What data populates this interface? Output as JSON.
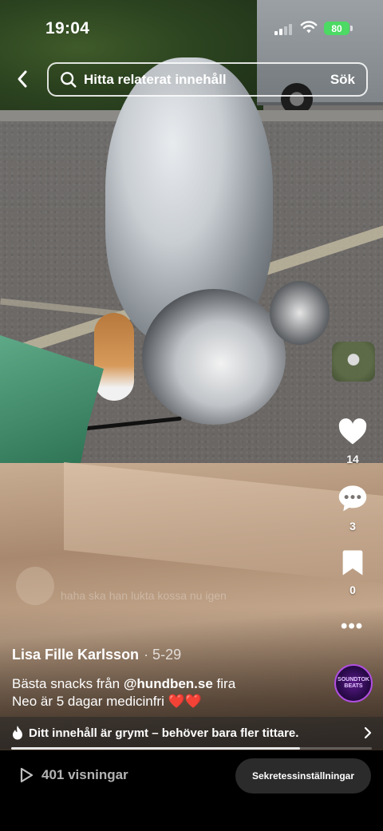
{
  "status_bar": {
    "time": "19:04",
    "battery": "80"
  },
  "search": {
    "placeholder": "Hitta relaterat innehåll",
    "button": "Sök"
  },
  "rail": {
    "likes": "14",
    "comments": "3",
    "saves": "0"
  },
  "ghost_caption": {
    "text": "haha ska han lukta kossa nu igen"
  },
  "post": {
    "author": "Lisa Fille Karlsson",
    "date": "· 5-29",
    "caption_before": "Bästa snacks från ",
    "mention": "@hundben.se",
    "caption_after": "  fira",
    "caption_line2": "Neo är 5 dagar medicinfri ",
    "hearts": "❤️❤️"
  },
  "music": {
    "line1": "SOUNDTOK",
    "line2": "BEATS"
  },
  "promo": {
    "text": "Ditt innehåll är grymt – behöver bara fler tittare."
  },
  "playback": {
    "progress": 0.8
  },
  "bottom": {
    "views": "401 visningar",
    "privacy_button": "Sekretessinställningar"
  },
  "icons": [
    "back-arrow-icon",
    "search-icon",
    "heart-icon",
    "comment-icon",
    "bookmark-icon",
    "more-icon",
    "fire-icon",
    "chevron-right-icon",
    "play-icon"
  ]
}
